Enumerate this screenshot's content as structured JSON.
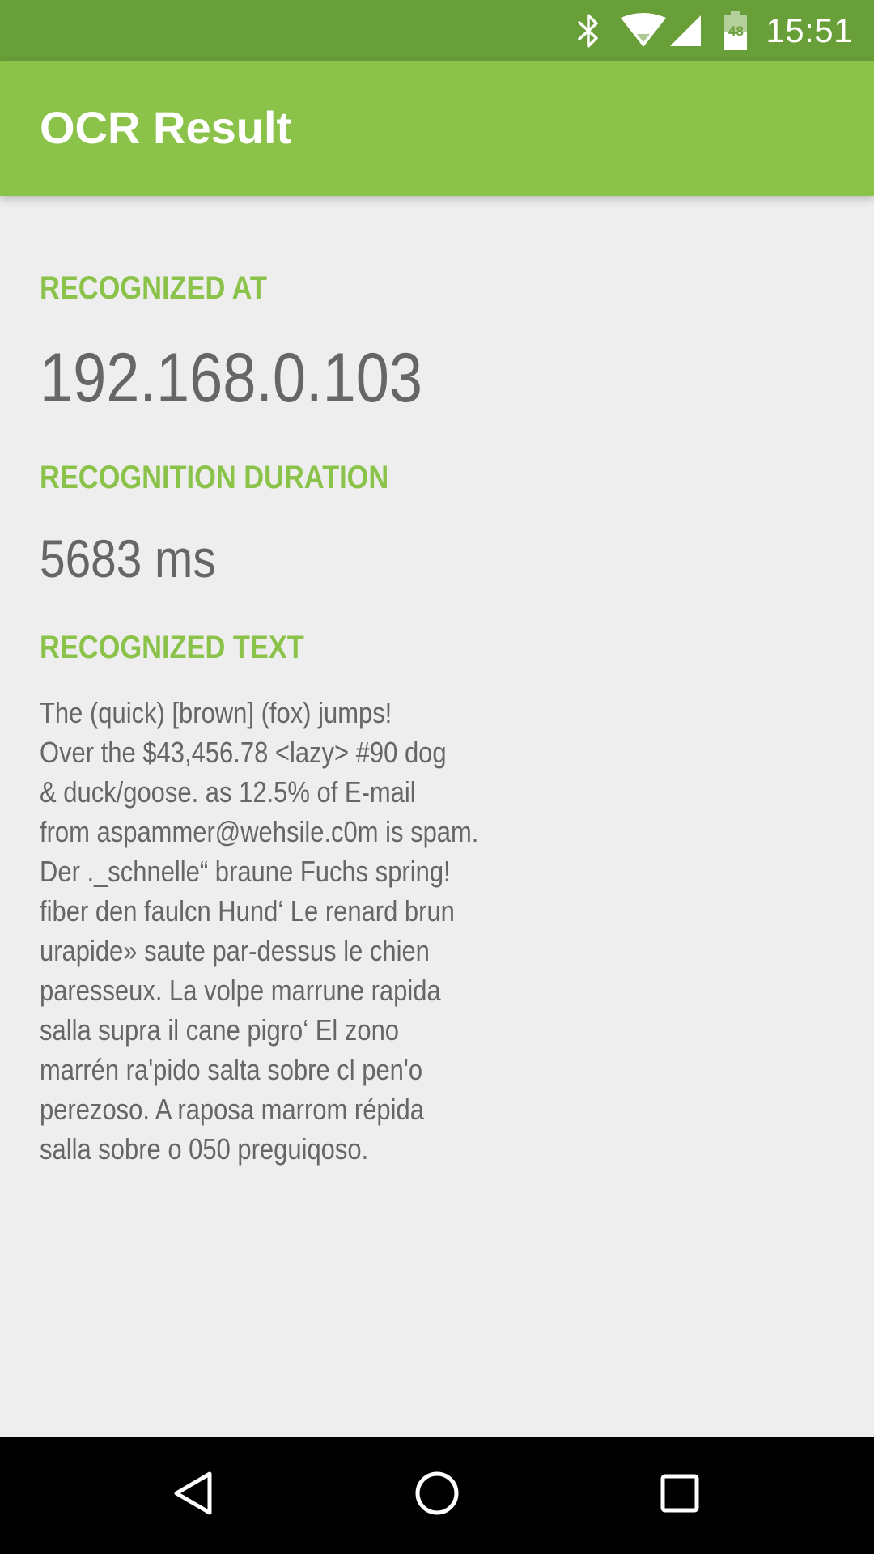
{
  "status_bar": {
    "time": "15:51",
    "battery_level": "48",
    "icons": [
      "bluetooth-icon",
      "wifi-icon",
      "cell-signal-icon",
      "battery-icon"
    ]
  },
  "app_bar": {
    "title": "OCR Result"
  },
  "result": {
    "recognized_at_label": "RECOGNIZED AT",
    "recognized_at_value": "192.168.0.103",
    "duration_label": "RECOGNITION DURATION",
    "duration_value": "5683 ms",
    "text_label": "RECOGNIZED TEXT",
    "text_value": "The (quick) [brown] (fox) jumps!\nOver the $43,456.78 <lazy> #90 dog\n& duck/goose. as 12.5% of E-mail\nfrom aspammer@wehsile.c0m is spam.\nDer ._schnelle“ braune Fuchs spring!\nfiber den faulcn Hund‘ Le renard brun\nurapide» saute par-dessus le chien\nparesseux. La volpe marrune rapida\nsalla supra il cane pigro‘ El zono\nmarrén ra'pido salta sobre cl pen'o\nperezoso. A raposa marrom répida\nsalla sobre o 050 preguiqoso."
  },
  "nav_bar": {
    "buttons": [
      "back-icon",
      "home-icon",
      "recents-icon"
    ]
  },
  "colors": {
    "status_bar": "#689f38",
    "app_bar": "#8bc34a",
    "accent_label": "#8bc34a",
    "body_text": "#666666",
    "background": "#eeeeee",
    "nav_bar": "#000000"
  }
}
